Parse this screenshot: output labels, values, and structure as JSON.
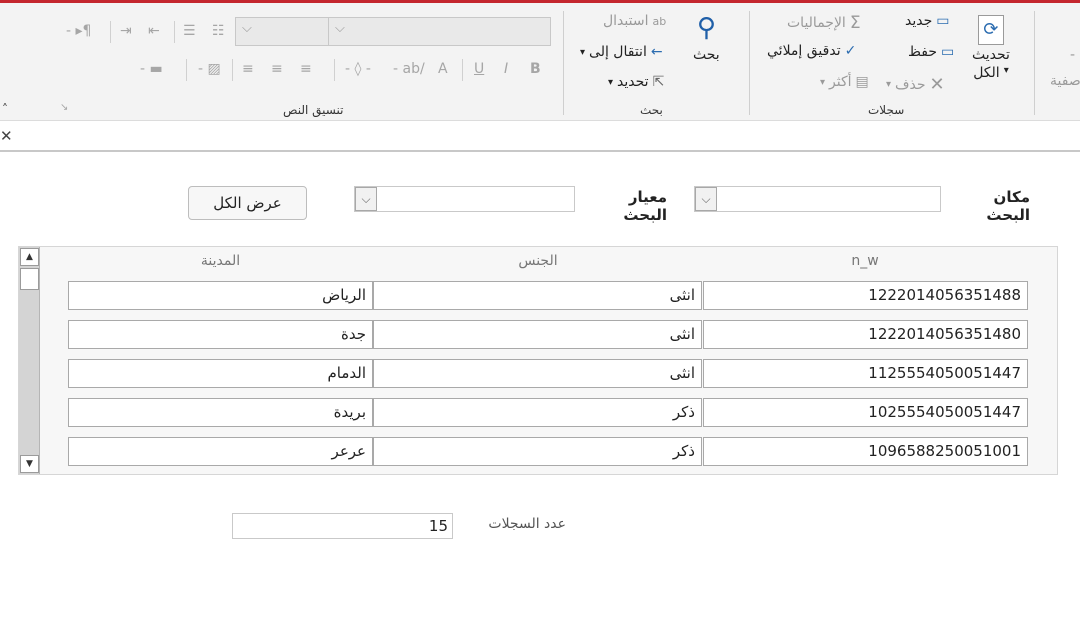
{
  "ribbon": {
    "groups": {
      "records": "سجلات",
      "find": "بحث",
      "text_format": "تنسيق النص"
    },
    "refresh_all": [
      "تحديث",
      "الكل"
    ],
    "new": "جديد",
    "save": "حفظ",
    "delete": "حذف",
    "totals": "الإجماليات",
    "spelling": "تدقيق إملائي",
    "more": "أكثر",
    "find": "بحث",
    "replace": "استبدال",
    "goto": "انتقال إلى",
    "select": "تحديد",
    "partial_left": "صفية"
  },
  "form": {
    "search_location_label": "مكان البحث",
    "search_criteria_label": "معيار البحث",
    "show_all_button": "عرض الكل",
    "record_count_label": "عدد السجلات",
    "record_count_value": "15"
  },
  "table": {
    "headers": [
      "n_w",
      "الجنس",
      "المدينة"
    ],
    "rows": [
      [
        "1222014056351488",
        "انثى",
        "الرياض"
      ],
      [
        "1222014056351480",
        "انثى",
        "جدة"
      ],
      [
        "1125554050051447",
        "انثى",
        "الدمام"
      ],
      [
        "1025554050051447",
        "ذكر",
        "بريدة"
      ],
      [
        "1096588250051001",
        "ذكر",
        "عرعر"
      ]
    ]
  },
  "colors": {
    "accent": "#c4262e",
    "ribbon_bg": "#f3f3f3",
    "find_icon": "#1f5fa8"
  }
}
